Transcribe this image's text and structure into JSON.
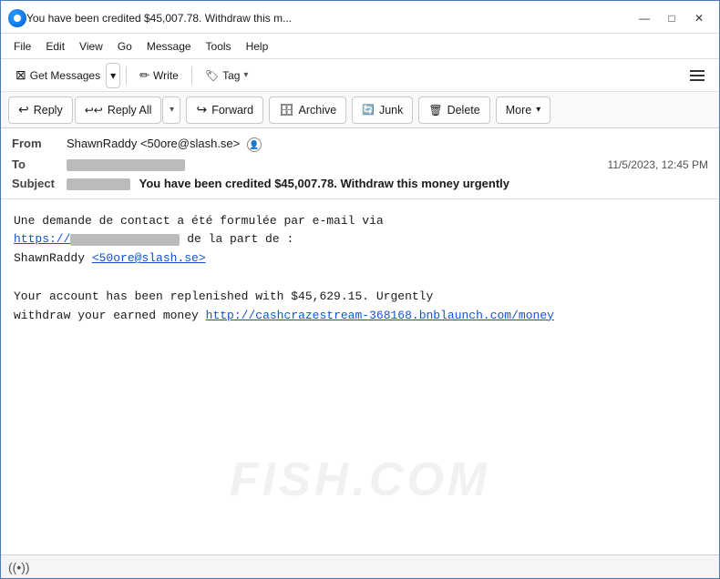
{
  "window": {
    "title": "You have been credited $45,007.78. Withdraw this m...",
    "controls": {
      "minimize": "—",
      "maximize": "□",
      "close": "✕"
    }
  },
  "menu": {
    "items": [
      "File",
      "Edit",
      "View",
      "Go",
      "Message",
      "Tools",
      "Help"
    ]
  },
  "toolbar": {
    "get_messages_label": "Get Messages",
    "write_label": "Write",
    "tag_label": "Tag"
  },
  "action_toolbar": {
    "reply_label": "Reply",
    "reply_all_label": "Reply All",
    "forward_label": "Forward",
    "archive_label": "Archive",
    "junk_label": "Junk",
    "delete_label": "Delete",
    "more_label": "More"
  },
  "email": {
    "from_label": "From",
    "from_value": "ShawnRaddy <50ore@slash.se>",
    "to_label": "To",
    "to_value": "[redacted]",
    "date_value": "11/5/2023, 12:45 PM",
    "subject_label": "Subject",
    "subject_prefix": "[redacted]",
    "subject_main": "You have been credited $45,007.78. Withdraw this money urgently",
    "body_line1": "Une demande de contact a été formulée par e-mail via",
    "body_link1": "https://[redacted]",
    "body_line2": " de la part de :",
    "body_line3": "ShawnRaddy",
    "body_email_link": "<50ore@slash.se>",
    "body_para2_line1": "Your account has been replenished with $45,629.15. Urgently",
    "body_para2_line2": "withdraw your earned money",
    "body_link2": "http://cashcrazestream-368168.bnblaunch.com/money"
  },
  "watermark": {
    "text": "FISH.COM"
  },
  "status_bar": {
    "wifi_symbol": "((•))"
  }
}
